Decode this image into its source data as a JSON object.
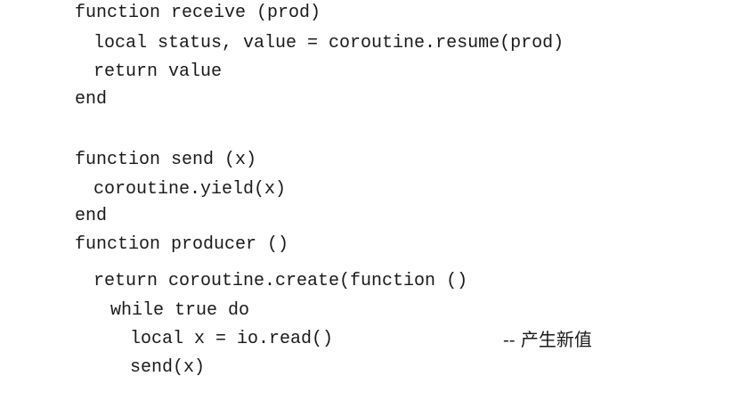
{
  "code": {
    "lines": [
      "function receive (prod)",
      "local status, value = coroutine.resume(prod)",
      "return value",
      "end",
      "function send (x)",
      "coroutine.yield(x)",
      "end",
      "function producer ()",
      "return coroutine.create(function ()",
      "while true do",
      "local x = io.read()",
      "send(x)"
    ],
    "comment": "-- 产生新值"
  }
}
